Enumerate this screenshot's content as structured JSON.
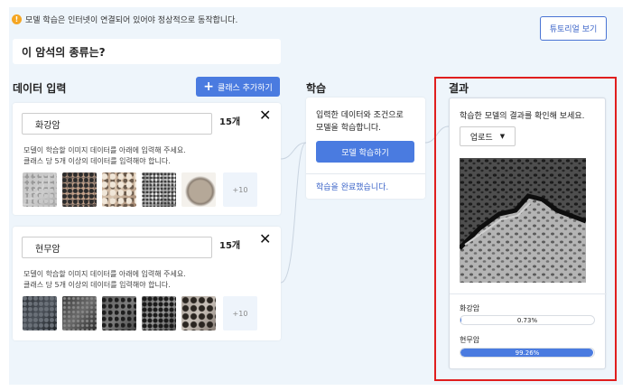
{
  "notice": {
    "icon": "warning-icon",
    "text": "모델 학습은 인터넷이 연결되어 있어야 정상적으로 동작합니다."
  },
  "tutorial_button": "튜토리얼 보기",
  "question": "이 암석의 종류는?",
  "data_input": {
    "title": "데이터 입력",
    "add_class_label": "클래스 추가하기",
    "classes": [
      {
        "name": "화강암",
        "count": "15개",
        "description_line1": "모델이 학습할 이미지 데이터를 아래에 입력해 주세요.",
        "description_line2": "클래스 당 5개 이상의 데이터를 입력해야 합니다.",
        "more_label": "+10"
      },
      {
        "name": "현무암",
        "count": "15개",
        "description_line1": "모델이 학습할 이미지 데이터를 아래에 입력해 주세요.",
        "description_line2": "클래스 당 5개 이상의 데이터를 입력해야 합니다.",
        "more_label": "+10"
      }
    ]
  },
  "learning": {
    "title": "학습",
    "description_line1": "입력한 데이터와 조건으로",
    "description_line2": "모델을 학습합니다.",
    "button_label": "모델 학습하기",
    "status": "학습을 완료했습니다."
  },
  "result": {
    "title": "결과",
    "description": "학습한 모델의 결과를 확인해 보세요.",
    "upload_label": "업로드",
    "predictions": [
      {
        "label": "화강암",
        "value": 0.73,
        "text": "0.73%"
      },
      {
        "label": "현무암",
        "value": 99.26,
        "text": "99.26%"
      }
    ]
  },
  "colors": {
    "accent": "#4a7be0",
    "highlight": "#e01e1e",
    "warning": "#f5a623",
    "background": "#eef5fb"
  }
}
